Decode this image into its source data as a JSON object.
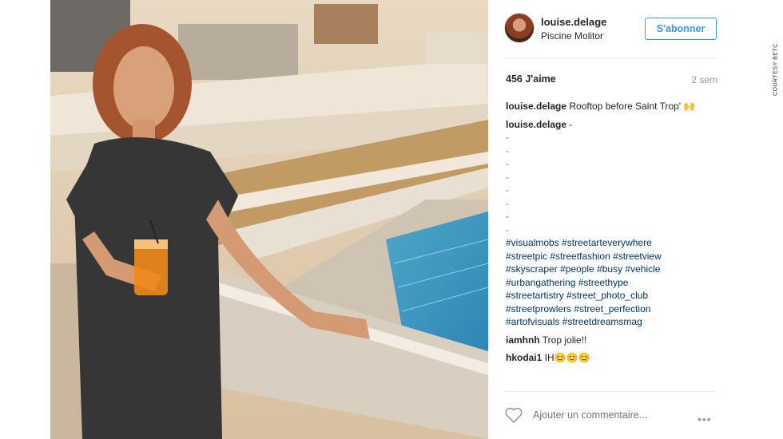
{
  "post": {
    "username": "louise.delage",
    "location": "Piscine Molitor",
    "follow_label": "S'abonner",
    "likes": "456 J'aime",
    "time": "2 sem"
  },
  "comments": [
    {
      "user": "louise.delage",
      "text": "Rooftop before Saint Trop' 🙌"
    },
    {
      "user": "louise.delage",
      "text": "-"
    }
  ],
  "dashes": [
    "-",
    "-",
    "-",
    "-",
    "-",
    "-",
    "-",
    "-"
  ],
  "hashtags": [
    "#visualmobs #streetarteverywhere",
    "#streetpic #streetfashion #streetview",
    "#skyscraper #people #busy #vehicle",
    "#urbangathering #streethype",
    "#streetartistry #street_photo_club",
    "#streetprowlers #street_perfection",
    "#artofvisuals #streetdreamsmag"
  ],
  "replies": [
    {
      "user": "iamhnh",
      "text": "Trop jolie!!"
    },
    {
      "user": "hkodai1",
      "text": "IH😊😊😊"
    }
  ],
  "add_comment_placeholder": "Ajouter un commentaire...",
  "more_label": "•••",
  "credit": "COURTESY BETC",
  "icons": {
    "heart": "heart-icon",
    "more": "more-options-icon"
  }
}
